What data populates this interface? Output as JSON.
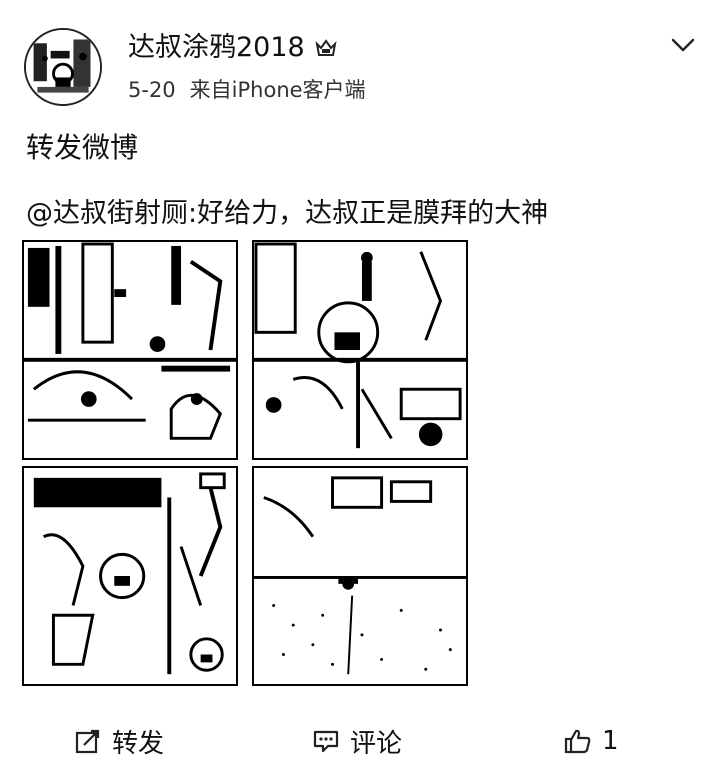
{
  "post": {
    "author": "达叔涂鸦2018",
    "timestamp": "5-20",
    "source": "来自iPhone客户端",
    "repost_text": "转发微博",
    "original_text": "@达叔街射厕:好给力，达叔正是膜拜的大神"
  },
  "actions": {
    "repost_label": "转发",
    "comment_label": "评论",
    "like_count": "1"
  },
  "icons": {
    "badge": "crown-badge-icon",
    "menu": "chevron-down-icon",
    "repost": "share-edit-icon",
    "comment": "comment-icon",
    "like": "thumbs-up-icon"
  },
  "colors": {
    "text": "#111111",
    "background": "#ffffff"
  }
}
